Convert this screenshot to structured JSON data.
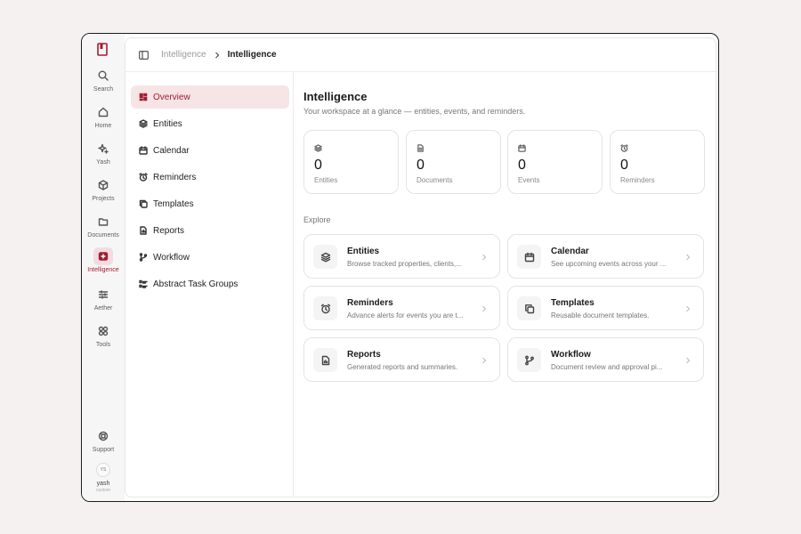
{
  "rail": {
    "items": [
      {
        "label": "Search",
        "icon": "search-icon"
      },
      {
        "label": "Home",
        "icon": "home-icon"
      },
      {
        "label": "Yash",
        "icon": "sparkles-icon"
      },
      {
        "label": "Projects",
        "icon": "box-icon"
      },
      {
        "label": "Documents",
        "icon": "folder-icon"
      },
      {
        "label": "Intelligence",
        "icon": "intelligence-icon",
        "active": true
      },
      {
        "label": "Aether",
        "icon": "sliders-icon"
      },
      {
        "label": "Tools",
        "icon": "grid-icon"
      }
    ],
    "support_label": "Support",
    "user": {
      "initials": "YS",
      "name": "yash",
      "role": "custom"
    }
  },
  "breadcrumb": {
    "parent": "Intelligence",
    "current": "Intelligence"
  },
  "subnav": {
    "items": [
      {
        "label": "Overview",
        "icon": "dashboard-icon",
        "active": true
      },
      {
        "label": "Entities",
        "icon": "layers-icon"
      },
      {
        "label": "Calendar",
        "icon": "calendar-icon"
      },
      {
        "label": "Reminders",
        "icon": "alarm-icon"
      },
      {
        "label": "Templates",
        "icon": "copy-icon"
      },
      {
        "label": "Reports",
        "icon": "report-icon"
      },
      {
        "label": "Workflow",
        "icon": "branch-icon"
      },
      {
        "label": "Abstract Task Groups",
        "icon": "list-icon"
      }
    ]
  },
  "main": {
    "title": "Intelligence",
    "subtitle": "Your workspace at a glance — entities, events, and reminders.",
    "stats": [
      {
        "value": "0",
        "label": "Entities",
        "icon": "layers-icon"
      },
      {
        "value": "0",
        "label": "Documents",
        "icon": "document-icon"
      },
      {
        "value": "0",
        "label": "Events",
        "icon": "calendar-icon"
      },
      {
        "value": "0",
        "label": "Reminders",
        "icon": "alarm-icon"
      }
    ],
    "explore_label": "Explore",
    "cards": [
      {
        "title": "Entities",
        "desc": "Browse tracked properties, clients,...",
        "icon": "layers-icon"
      },
      {
        "title": "Calendar",
        "desc": "See upcoming events across your ...",
        "icon": "calendar-icon"
      },
      {
        "title": "Reminders",
        "desc": "Advance alerts for events you are t...",
        "icon": "alarm-icon"
      },
      {
        "title": "Templates",
        "desc": "Reusable document templates.",
        "icon": "copy-icon"
      },
      {
        "title": "Reports",
        "desc": "Generated reports and summaries.",
        "icon": "report-icon"
      },
      {
        "title": "Workflow",
        "desc": "Document review and approval pi...",
        "icon": "branch-icon"
      }
    ]
  },
  "colors": {
    "accent": "#a31d31",
    "accent_bg": "#f6e4e6"
  }
}
